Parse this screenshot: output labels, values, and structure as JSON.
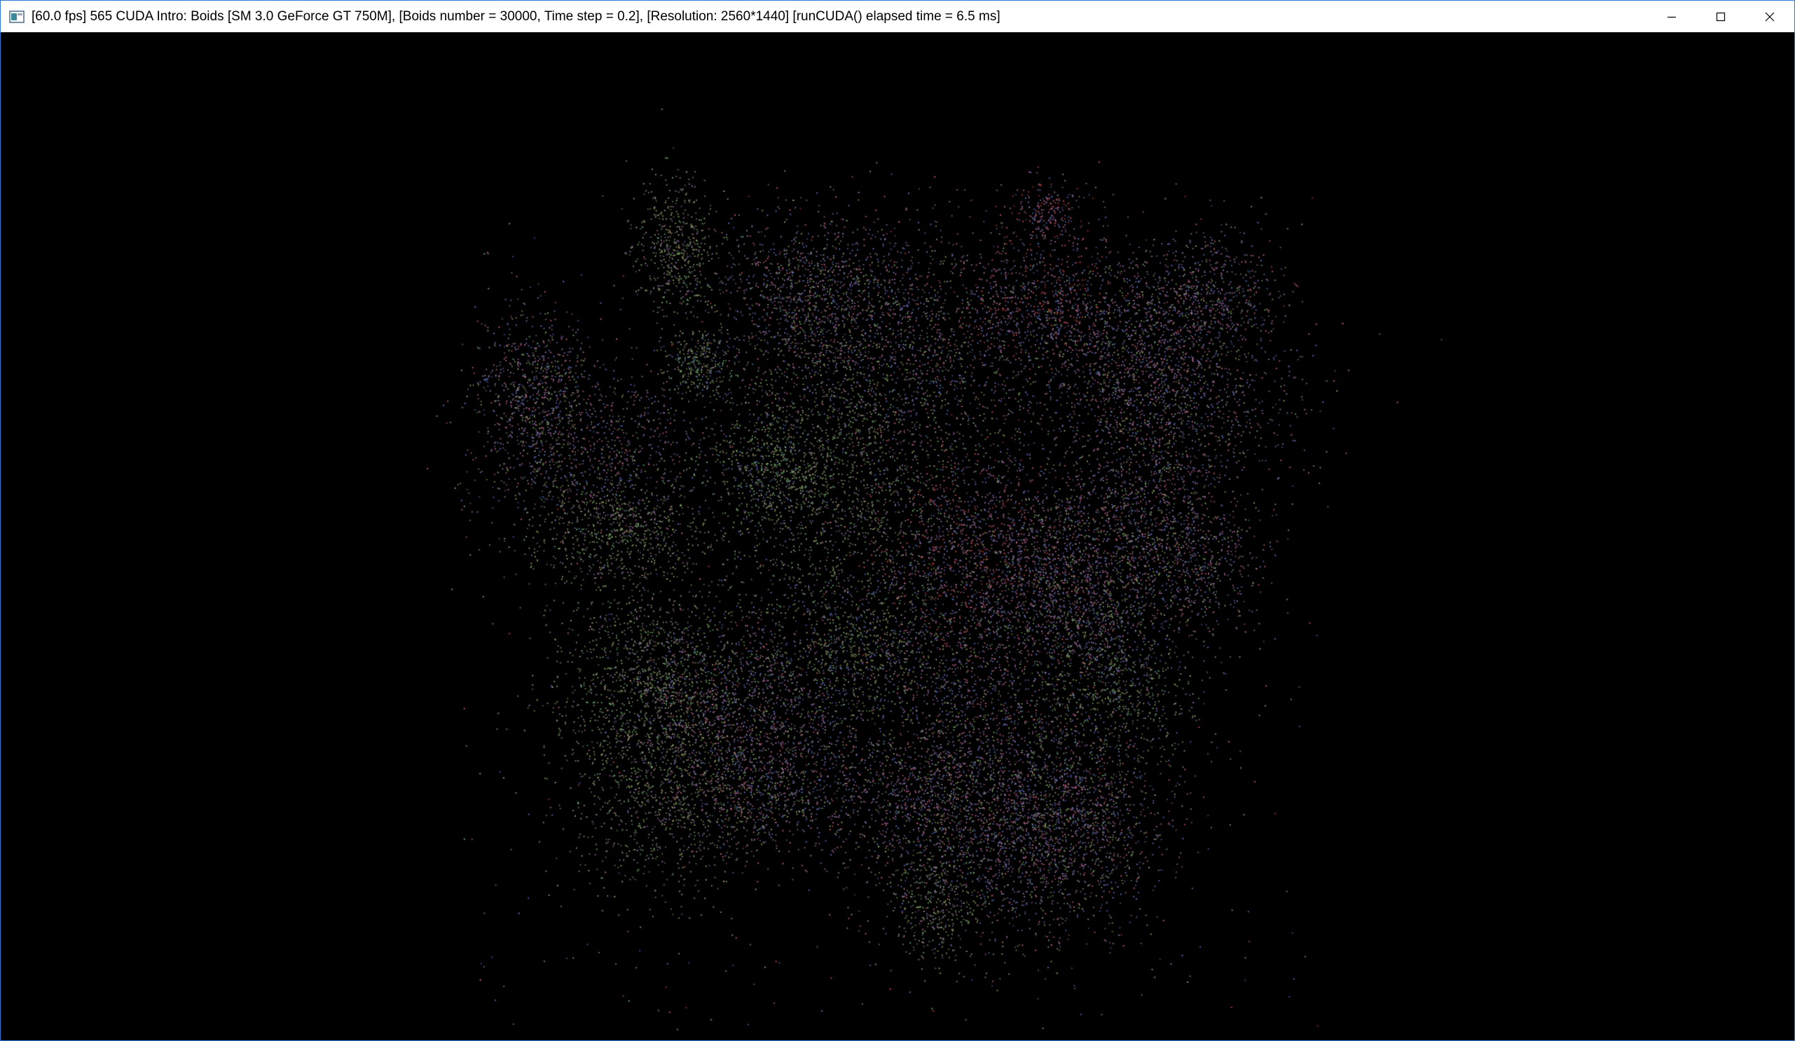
{
  "window": {
    "title": "[60.0 fps] 565 CUDA Intro: Boids [SM 3.0 GeForce GT 750M], [Boids number = 30000, Time step = 0.2], [Resolution: 2560*1440] [runCUDA() elapsed time = 6.5 ms]",
    "app_icon": "console-window-icon",
    "controls": {
      "minimize_icon": "minimize-icon",
      "maximize_icon": "maximize-icon",
      "close_icon": "close-icon"
    }
  },
  "colors": {
    "background": "#000000",
    "titlebar": "#ffffff",
    "window_border": "#2b7bd6",
    "particle_palette": [
      "#7a9a5a",
      "#8a6a9a",
      "#5a6ab0",
      "#b05a7a",
      "#6aa06a",
      "#9a8a6a",
      "#c04040",
      "#4060c0"
    ]
  },
  "simulation": {
    "fps": "60.0",
    "boids_number": 30000,
    "time_step": 0.2,
    "resolution": "2560*1440",
    "elapsed_ms": 6.5
  }
}
